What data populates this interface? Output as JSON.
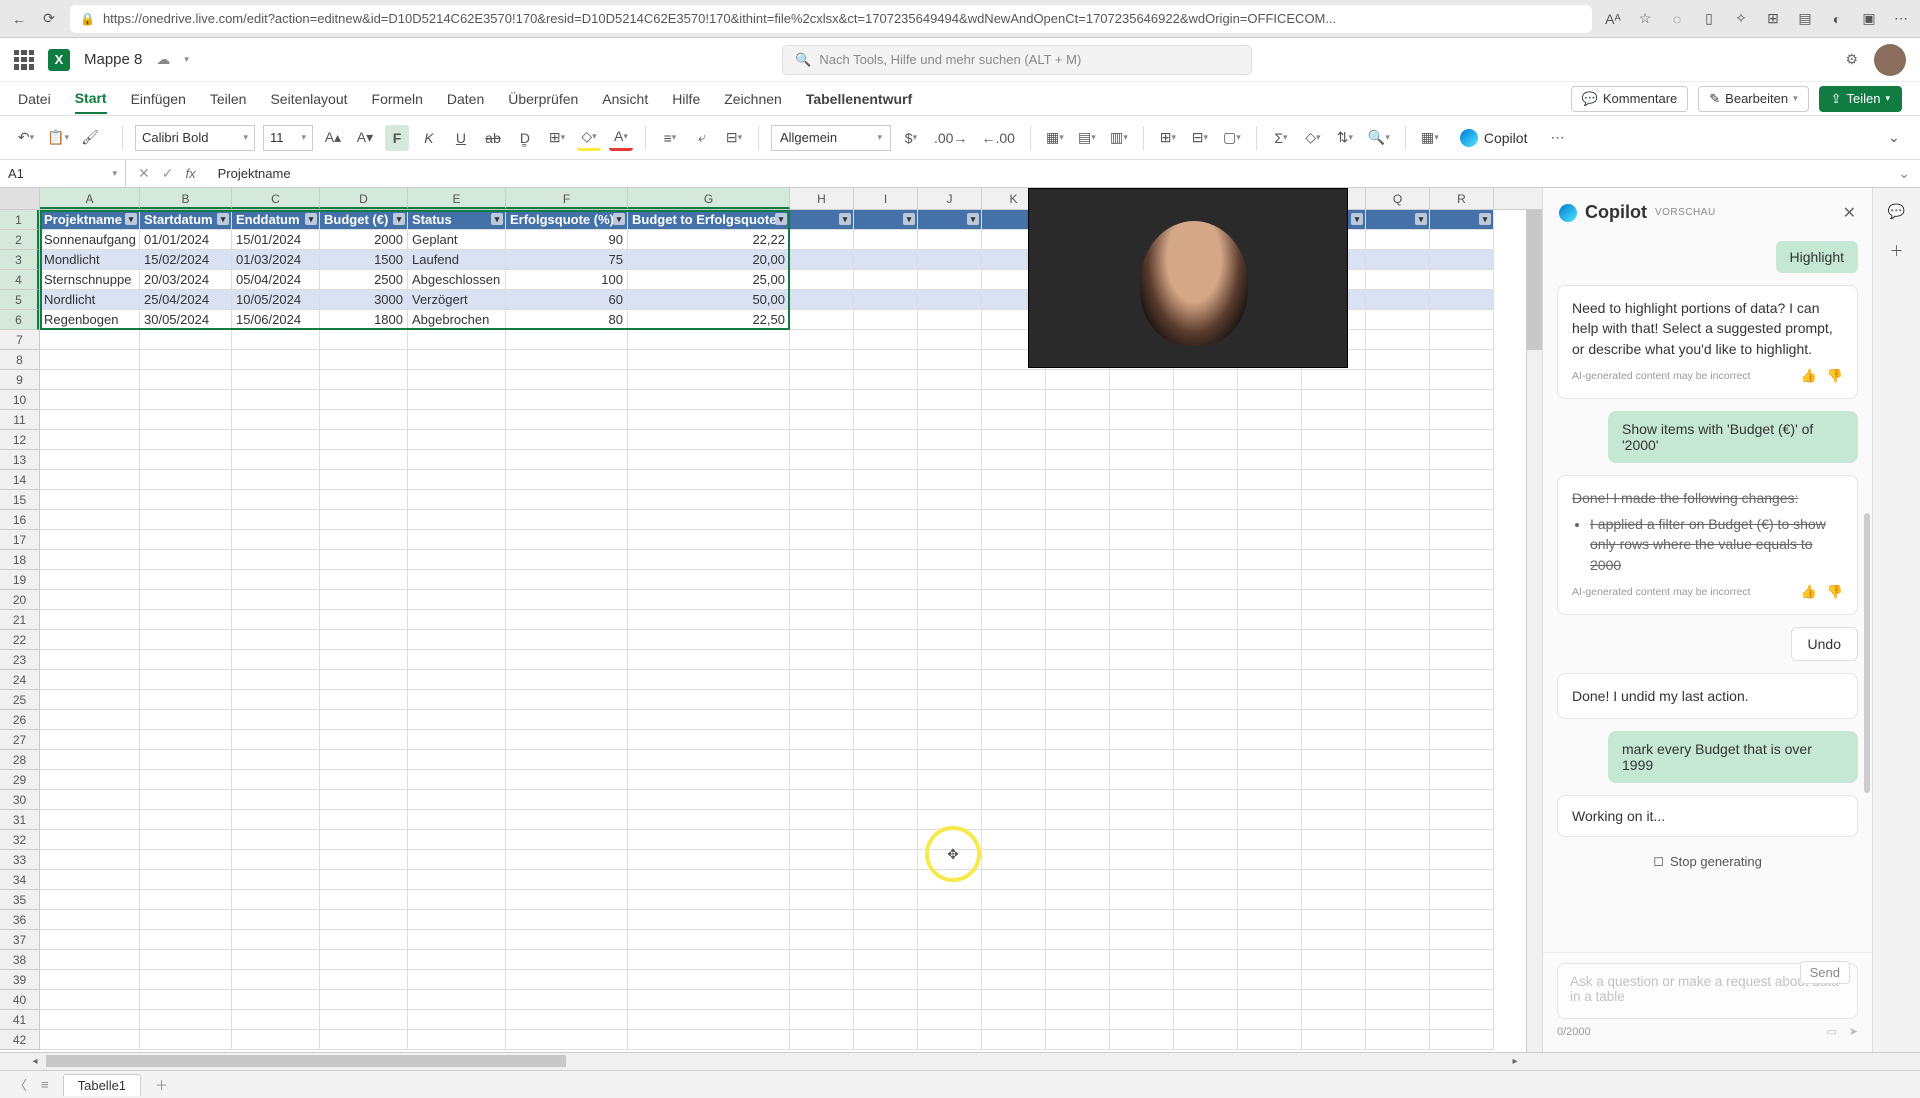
{
  "browser": {
    "url": "https://onedrive.live.com/edit?action=editnew&id=D10D5214C62E3570!170&resid=D10D5214C62E3570!170&ithint=file%2cxlsx&ct=1707235649494&wdNewAndOpenCt=1707235646922&wdOrigin=OFFICECOM..."
  },
  "doc": {
    "name": "Mappe 8"
  },
  "search": {
    "placeholder": "Nach Tools, Hilfe und mehr suchen (ALT + M)"
  },
  "tabs": {
    "t0": "Datei",
    "t1": "Start",
    "t2": "Einfügen",
    "t3": "Teilen",
    "t4": "Seitenlayout",
    "t5": "Formeln",
    "t6": "Daten",
    "t7": "Überprüfen",
    "t8": "Ansicht",
    "t9": "Hilfe",
    "t10": "Zeichnen",
    "t11": "Tabellenentwurf"
  },
  "ribbon_right": {
    "comments": "Kommentare",
    "edit": "Bearbeiten",
    "share": "Teilen"
  },
  "toolbar": {
    "font": "Calibri Bold",
    "size": "11",
    "format": "Allgemein",
    "copilot": "Copilot"
  },
  "namebox": "A1",
  "formula": "Projektname",
  "cols": {
    "A": "A",
    "B": "B",
    "C": "C",
    "D": "D",
    "E": "E",
    "F": "F",
    "G": "G",
    "H": "H",
    "I": "I",
    "J": "J",
    "K": "K",
    "Q": "Q",
    "R": "R"
  },
  "headers": {
    "c0": "Projektname",
    "c1": "Startdatum",
    "c2": "Enddatum",
    "c3": "Budget (€)",
    "c4": "Status",
    "c5": "Erfolgsquote (%)",
    "c6": "Budget to Erfolgsquote"
  },
  "data": [
    {
      "c0": "Sonnenaufgang",
      "c1": "01/01/2024",
      "c2": "15/01/2024",
      "c3": "2000",
      "c4": "Geplant",
      "c5": "90",
      "c6": "22,22"
    },
    {
      "c0": "Mondlicht",
      "c1": "15/02/2024",
      "c2": "01/03/2024",
      "c3": "1500",
      "c4": "Laufend",
      "c5": "75",
      "c6": "20,00"
    },
    {
      "c0": "Sternschnuppe",
      "c1": "20/03/2024",
      "c2": "05/04/2024",
      "c3": "2500",
      "c4": "Abgeschlossen",
      "c5": "100",
      "c6": "25,00"
    },
    {
      "c0": "Nordlicht",
      "c1": "25/04/2024",
      "c2": "10/05/2024",
      "c3": "3000",
      "c4": "Verzögert",
      "c5": "60",
      "c6": "50,00"
    },
    {
      "c0": "Regenbogen",
      "c1": "30/05/2024",
      "c2": "15/06/2024",
      "c3": "1800",
      "c4": "Abgebrochen",
      "c5": "80",
      "c6": "22,50"
    }
  ],
  "copilot": {
    "title": "Copilot",
    "badge": "VORSCHAU",
    "chip_highlight": "Highlight",
    "bot1": "Need to highlight portions of data? I can help with that! Select a suggested prompt, or describe what you'd like to highlight.",
    "disclaimer": "AI-generated content may be incorrect",
    "user1": "Show items with 'Budget (€)' of '2000'",
    "bot2_intro": "Done! I made the following changes:",
    "bot2_item": "I applied a filter on Budget (€) to show only rows where the value equals to 2000",
    "undo": "Undo",
    "bot3": "Done! I undid my last action.",
    "user2": "mark every Budget that is over 1999",
    "working": "Working on it...",
    "stop": "Stop generating",
    "input_placeholder": "Ask a question or make a request about data in a table",
    "counter": "0/2000",
    "send": "Send"
  },
  "sheet": {
    "name": "Tabelle1"
  }
}
